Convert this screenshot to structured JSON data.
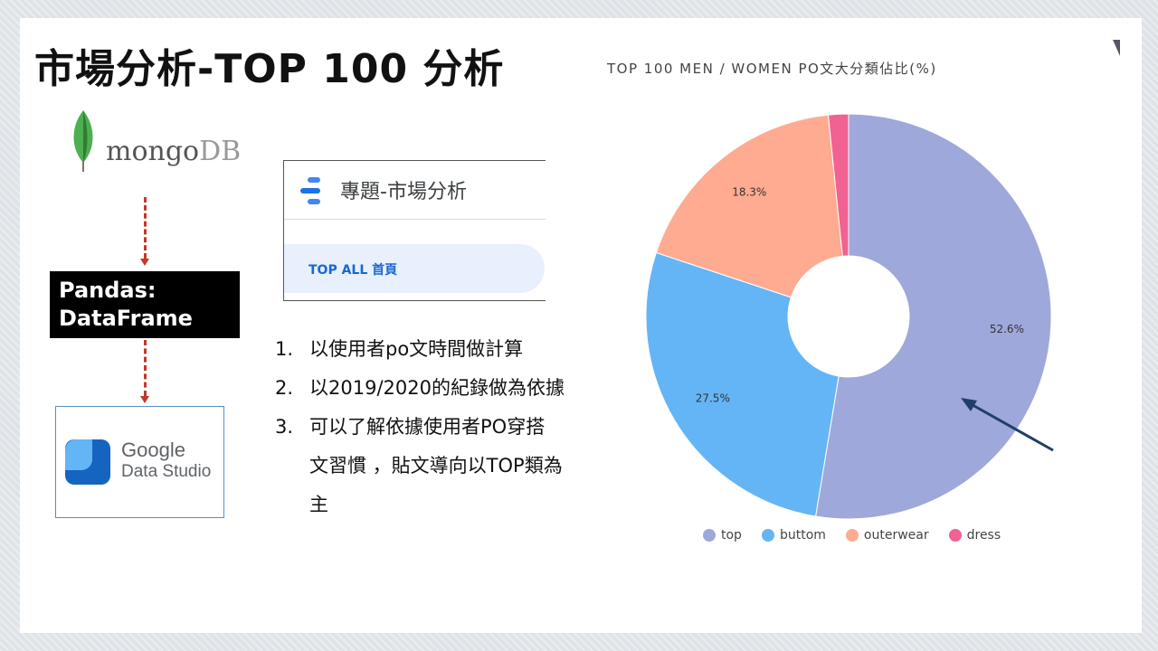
{
  "slide": {
    "title": "市場分析-TOP 100 分析"
  },
  "flow": {
    "mongo_label": "mongo",
    "mongo_label_db": "DB",
    "pandas_line1": "Pandas:",
    "pandas_line2": "DataFrame",
    "gds_line1": "Google",
    "gds_line2": "Data Studio"
  },
  "panel": {
    "title": "專題-市場分析",
    "nav_item": "TOP ALL 首頁"
  },
  "list": {
    "items": [
      {
        "num": "1.",
        "text": "以使用者po文時間做計算"
      },
      {
        "num": "2.",
        "text": "以2019/2020的紀錄做為依據"
      },
      {
        "num": "3.",
        "text": "可以了解依據使用者PO穿搭"
      }
    ],
    "item3_line2": "文習慣 ，貼文導向以TOP類為",
    "item3_line3": "主"
  },
  "colors": {
    "top": "#9fa8da",
    "buttom": "#64b5f6",
    "outerwear": "#ffab91",
    "dress": "#f06292",
    "arrow": "#1f3f6b"
  },
  "chart_data": {
    "type": "pie",
    "title": "TOP 100 MEN / WOMEN PO文大分類佔比(%)",
    "categories": [
      "top",
      "buttom",
      "outerwear",
      "dress"
    ],
    "values": [
      52.6,
      27.5,
      18.3,
      1.6
    ],
    "data_labels": [
      "52.6%",
      "27.5%",
      "18.3%",
      ""
    ],
    "legend_position": "bottom",
    "donut": true
  }
}
